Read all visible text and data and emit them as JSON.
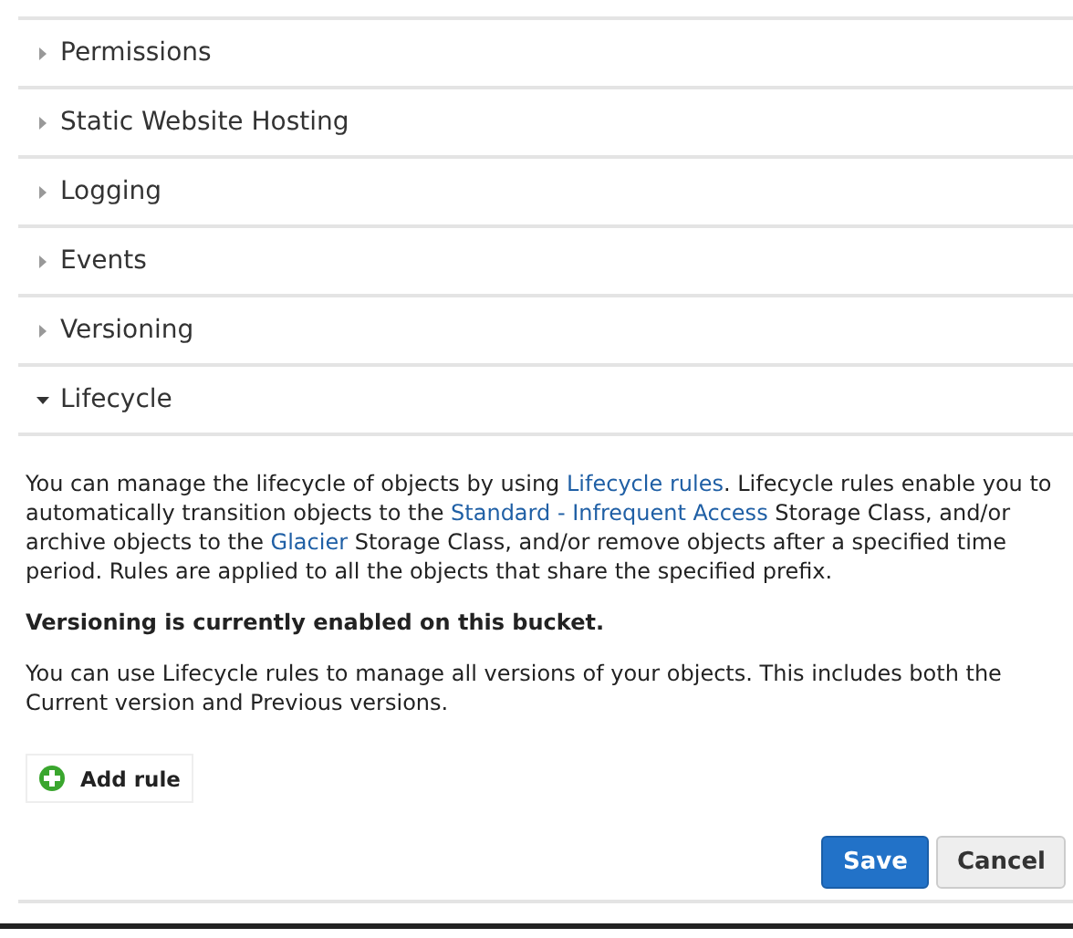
{
  "sections": [
    {
      "title": "Permissions",
      "expanded": false
    },
    {
      "title": "Static Website Hosting",
      "expanded": false
    },
    {
      "title": "Logging",
      "expanded": false
    },
    {
      "title": "Events",
      "expanded": false
    },
    {
      "title": "Versioning",
      "expanded": false
    },
    {
      "title": "Lifecycle",
      "expanded": true
    }
  ],
  "lifecycle": {
    "intro": [
      {
        "kind": "text",
        "text": "You can manage the lifecycle of objects by using "
      },
      {
        "kind": "link",
        "text": "Lifecycle rules"
      },
      {
        "kind": "text",
        "text": ". Lifecycle rules enable you to automatically transition objects to the "
      },
      {
        "kind": "link",
        "text": "Standard - Infrequent Access"
      },
      {
        "kind": "text",
        "text": " Storage Class, and/or archive objects to the "
      },
      {
        "kind": "link",
        "text": "Glacier"
      },
      {
        "kind": "text",
        "text": " Storage Class, and/or remove objects after a specified time period. Rules are applied to all the objects that share the specified prefix."
      }
    ],
    "notice": "Versioning is currently enabled on this bucket.",
    "versions_note": "You can use Lifecycle rules to manage all versions of your objects. This includes both the Current version and Previous versions.",
    "add_rule": "Add rule"
  },
  "buttons": [
    {
      "label": "Save",
      "kind": "primary"
    },
    {
      "label": "Cancel",
      "kind": "secondary"
    }
  ]
}
